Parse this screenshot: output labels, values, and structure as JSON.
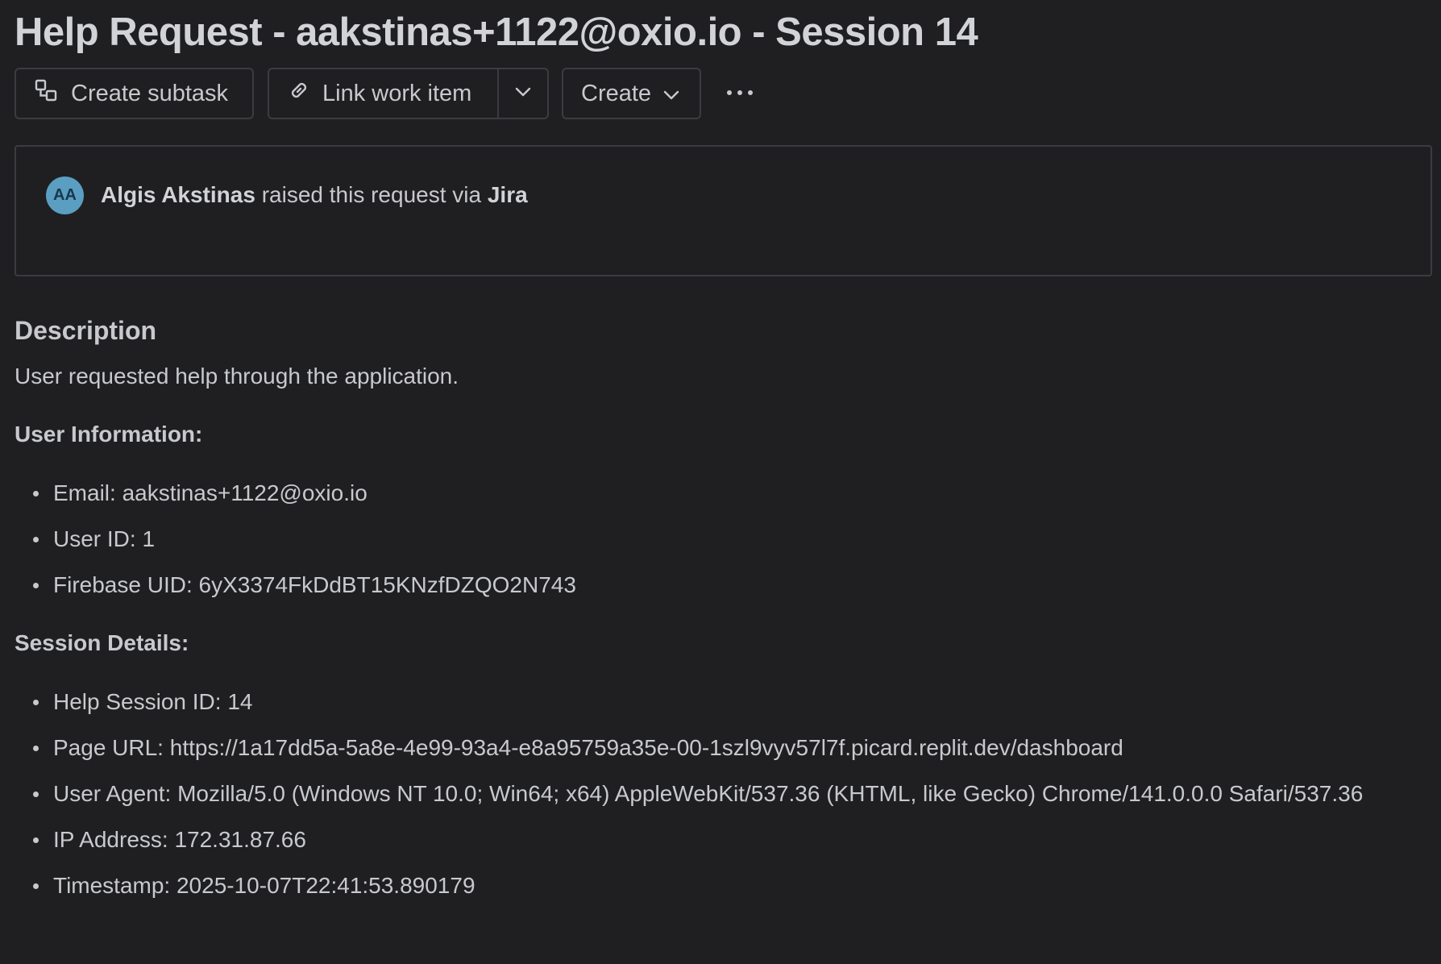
{
  "title": "Help Request - aakstinas+1122@oxio.io - Session 14",
  "toolbar": {
    "create_subtask": "Create subtask",
    "link_work_item": "Link work item",
    "create": "Create",
    "icons": {
      "subtask": "subtask-icon",
      "link": "link-icon",
      "chevron": "chevron-down-icon",
      "more": "more-icon"
    }
  },
  "request": {
    "avatar_initials": "AA",
    "avatar_color": "#5a9fc1",
    "reporter": "Algis Akstinas",
    "raised_text": "raised this request via",
    "channel": "Jira"
  },
  "description": {
    "heading": "Description",
    "intro": "User requested help through the application.",
    "user_info_heading": "User Information:",
    "user_info": [
      "Email: aakstinas+1122@oxio.io",
      "User ID: 1",
      "Firebase UID: 6yX3374FkDdBT15KNzfDZQO2N743"
    ],
    "session_heading": "Session Details:",
    "session_details": [
      "Help Session ID: 14",
      "Page URL: https://1a17dd5a-5a8e-4e99-93a4-e8a95759a35e-00-1szl9vyv57l7f.picard.replit.dev/dashboard",
      "User Agent: Mozilla/5.0 (Windows NT 10.0; Win64; x64) AppleWebKit/537.36 (KHTML, like Gecko) Chrome/141.0.0.0 Safari/537.36",
      "IP Address: 172.31.87.66",
      "Timestamp: 2025-10-07T22:41:53.890179"
    ]
  }
}
